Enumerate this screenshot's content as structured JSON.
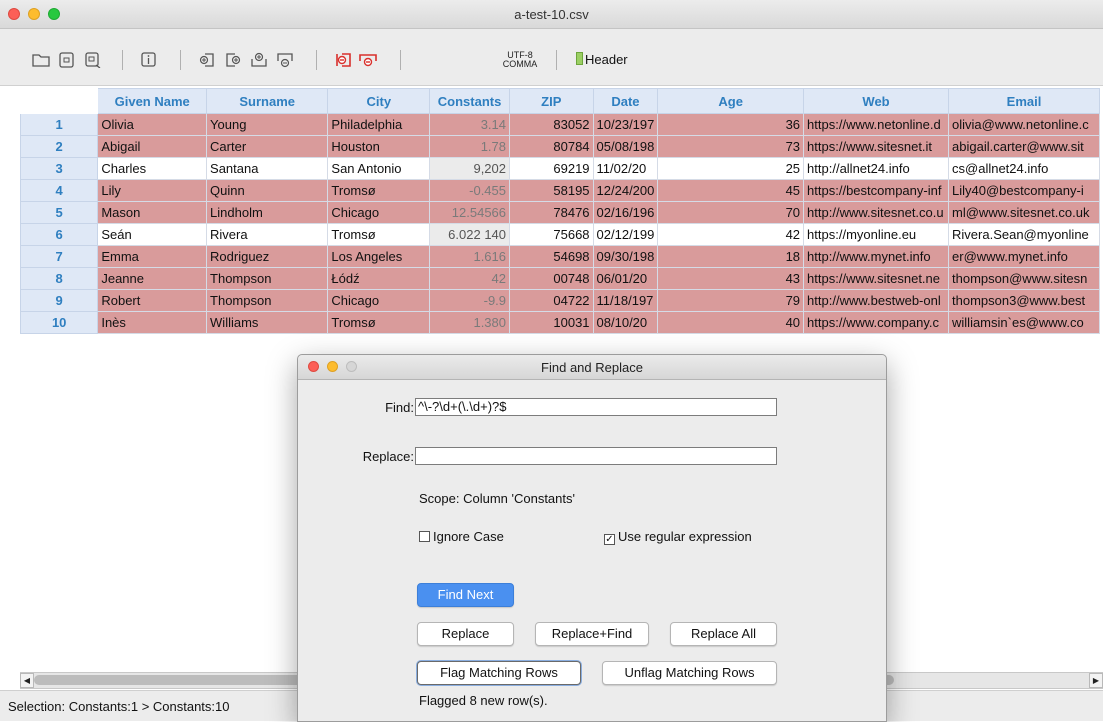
{
  "window": {
    "title": "a-test-10.csv"
  },
  "toolbar": {
    "icons": [
      "folder-open-icon",
      "save-icon",
      "save-as-icon",
      "info-icon",
      "insert-row-icon",
      "insert-column-icon",
      "add-icon",
      "remove-icon",
      "delete-row-icon",
      "delete-column-icon"
    ],
    "encoding_line1": "UTF-8",
    "encoding_line2": "COMMA",
    "header_label": "Header"
  },
  "colors": {
    "flagged_row": "#d99b9b",
    "header_text": "#2f7fc0",
    "primary_button": "#4a90f0"
  },
  "table": {
    "columns": [
      "Given Name",
      "Surname",
      "City",
      "Constants",
      "ZIP",
      "Date",
      "Age",
      "Web",
      "Email"
    ],
    "rows": [
      {
        "n": "1",
        "flag": true,
        "given": "Olivia",
        "surname": "Young",
        "city": "Philadelphia",
        "const": "3.14",
        "zip": "83052",
        "date": "10/23/197",
        "age": "36",
        "web": "https://www.netonline.d",
        "email": "olivia@www.netonline.c"
      },
      {
        "n": "2",
        "flag": true,
        "given": "Abigail",
        "surname": "Carter",
        "city": "Houston",
        "const": "1.78",
        "zip": "80784",
        "date": "05/08/198",
        "age": "73",
        "web": "https://www.sitesnet.it",
        "email": "abigail.carter@www.sit"
      },
      {
        "n": "3",
        "flag": false,
        "given": "Charles",
        "surname": "Santana",
        "city": "San Antonio",
        "const": "9,202",
        "zip": "69219",
        "date": "11/02/20",
        "age": "25",
        "web": "http://allnet24.info",
        "email": "cs@allnet24.info"
      },
      {
        "n": "4",
        "flag": true,
        "given": "Lily",
        "surname": "Quinn",
        "city": "Tromsø",
        "const": "-0.455",
        "zip": "58195",
        "date": "12/24/200",
        "age": "45",
        "web": "https://bestcompany-inf",
        "email": "Lily40@bestcompany-i"
      },
      {
        "n": "5",
        "flag": true,
        "given": "Mason",
        "surname": "Lindholm",
        "city": "Chicago",
        "const": "12.54566",
        "zip": "78476",
        "date": "02/16/196",
        "age": "70",
        "web": "http://www.sitesnet.co.u",
        "email": "ml@www.sitesnet.co.uk"
      },
      {
        "n": "6",
        "flag": false,
        "given": "Seán",
        "surname": "Rivera",
        "city": "Tromsø",
        "const": "6.022 140",
        "zip": "75668",
        "date": "02/12/199",
        "age": "42",
        "web": "https://myonline.eu",
        "email": "Rivera.Sean@myonline"
      },
      {
        "n": "7",
        "flag": true,
        "given": "Emma",
        "surname": "Rodriguez",
        "city": "Los Angeles",
        "const": "1.616",
        "zip": "54698",
        "date": "09/30/198",
        "age": "18",
        "web": "http://www.mynet.info",
        "email": "er@www.mynet.info"
      },
      {
        "n": "8",
        "flag": true,
        "given": "Jeanne",
        "surname": "Thompson",
        "city": "Łódź",
        "const": "42",
        "zip": "00748",
        "date": "06/01/20",
        "age": "43",
        "web": "https://www.sitesnet.ne",
        "email": "thompson@www.sitesn"
      },
      {
        "n": "9",
        "flag": true,
        "given": "Robert",
        "surname": "Thompson",
        "city": "Chicago",
        "const": "-9.9",
        "zip": "04722",
        "date": "11/18/197",
        "age": "79",
        "web": "http://www.bestweb-onl",
        "email": "thompson3@www.best"
      },
      {
        "n": "10",
        "flag": true,
        "given": "Inès",
        "surname": "Williams",
        "city": "Tromsø",
        "const": "1.380",
        "zip": "10031",
        "date": "08/10/20",
        "age": "40",
        "web": "https://www.company.c",
        "email": "williamsin`es@www.co"
      }
    ]
  },
  "status": {
    "selection": "Selection: Constants:1 > Constants:10"
  },
  "dialog": {
    "title": "Find and Replace",
    "find_label": "Find:",
    "find_value": "^\\-?\\d+(\\.\\d+)?$",
    "replace_label": "Replace:",
    "replace_value": "",
    "scope": "Scope: Column 'Constants'",
    "ignore_case_label": "Ignore Case",
    "ignore_case_checked": false,
    "regex_label": "Use regular expression",
    "regex_checked": true,
    "find_next": "Find Next",
    "replace": "Replace",
    "replace_find": "Replace+Find",
    "replace_all": "Replace All",
    "flag_rows": "Flag Matching Rows",
    "unflag_rows": "Unflag Matching Rows",
    "message": "Flagged 8 new row(s)."
  }
}
